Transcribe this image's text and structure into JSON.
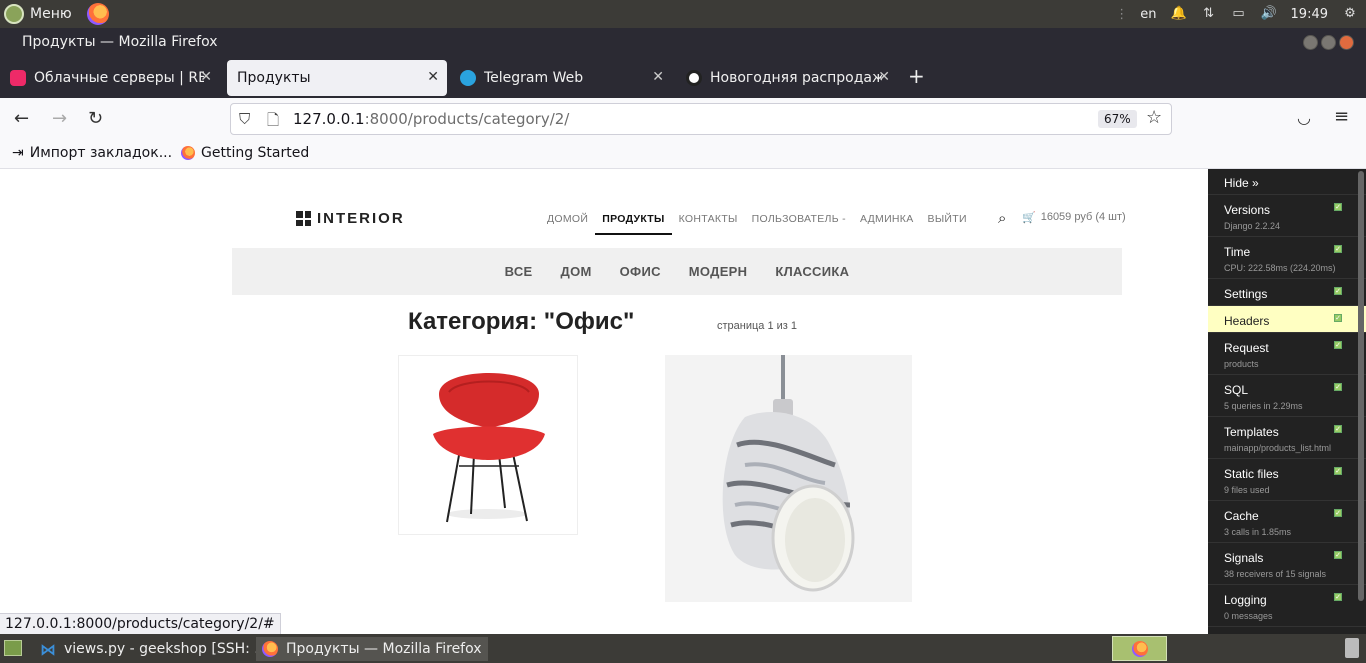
{
  "os_panel": {
    "menu_label": "Меню",
    "keyboard_layout": "en",
    "clock": "19:49"
  },
  "window": {
    "title": "Продукты — Mozilla Firefox"
  },
  "tabs": [
    {
      "label": "Облачные серверы | REG.RU",
      "favicon_color": "#ee2a68"
    },
    {
      "label": "Продукты",
      "favicon_color": ""
    },
    {
      "label": "Telegram Web",
      "favicon_color": "#2aa3df"
    },
    {
      "label": "Новогодняя распродажа",
      "favicon_color": "#222222"
    }
  ],
  "navbar": {
    "url_host": "127.0.0.1",
    "url_rest": ":8000/products/category/2/",
    "zoom": "67%"
  },
  "bookmarks": [
    {
      "label": "Импорт закладок...",
      "icon": "import-icon"
    },
    {
      "label": "Getting Started",
      "icon": "firefox-icon"
    }
  ],
  "site": {
    "logo": "INTERIOR",
    "nav": [
      "ДОМОЙ",
      "ПРОДУКТЫ",
      "КОНТАКТЫ",
      "ПОЛЬЗОВАТЕЛЬ -",
      "АДМИНКА",
      "ВЫЙТИ"
    ],
    "cart": "16059 руб (4 шт)",
    "categories": [
      "ВСЕ",
      "ДОМ",
      "ОФИС",
      "МОДЕРН",
      "КЛАССИКА"
    ],
    "heading": "Категория: \"Офис\"",
    "page_info": "страница 1 из 1",
    "products": [
      {
        "name": "red-chair",
        "icon": "chair-image"
      },
      {
        "name": "marble-lamp",
        "icon": "lamp-image"
      }
    ]
  },
  "status_link": "127.0.0.1:8000/products/category/2/#",
  "djdt": {
    "hide": "Hide »",
    "panels": [
      {
        "title": "Versions",
        "sub": "Django 2.2.24"
      },
      {
        "title": "Time",
        "sub": "CPU: 222.58ms (224.20ms)"
      },
      {
        "title": "Settings",
        "sub": ""
      },
      {
        "title": "Headers",
        "sub": ""
      },
      {
        "title": "Request",
        "sub": "products"
      },
      {
        "title": "SQL",
        "sub": "5 queries in 2.29ms"
      },
      {
        "title": "Templates",
        "sub": "mainapp/products_list.html"
      },
      {
        "title": "Static files",
        "sub": "9 files used"
      },
      {
        "title": "Cache",
        "sub": "3 calls in 1.85ms"
      },
      {
        "title": "Signals",
        "sub": "38 receivers of 15 signals"
      },
      {
        "title": "Logging",
        "sub": "0 messages"
      }
    ],
    "highlight_color": "#ffffc2"
  },
  "taskbar": {
    "tasks": [
      {
        "label": "views.py - geekshop [SSH: ..."
      },
      {
        "label": "Продукты — Mozilla Firefox"
      }
    ]
  }
}
